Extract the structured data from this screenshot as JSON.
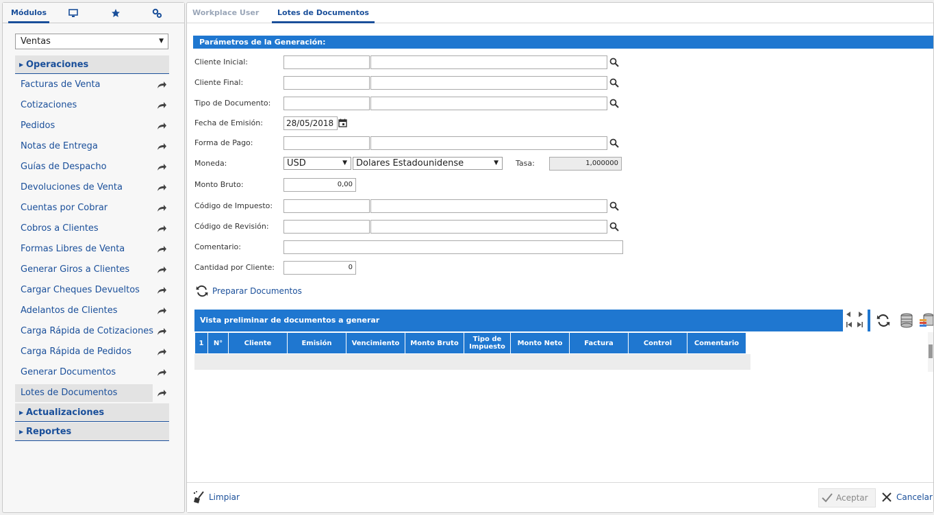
{
  "left_tabs": {
    "modules_label": "Módulos"
  },
  "module_select": {
    "value": "Ventas"
  },
  "sections": {
    "operaciones": "Operaciones",
    "actualizaciones": "Actualizaciones",
    "reportes": "Reportes"
  },
  "menu_items": [
    "Facturas de Venta",
    "Cotizaciones",
    "Pedidos",
    "Notas de Entrega",
    "Guías de Despacho",
    "Devoluciones de Venta",
    "Cuentas por Cobrar",
    "Cobros a Clientes",
    "Formas Libres de Venta",
    "Generar Giros a Clientes",
    "Cargar Cheques Devueltos",
    "Adelantos de Clientes",
    "Carga Rápida de Cotizaciones",
    "Carga Rápida de Pedidos",
    "Generar Documentos",
    "Lotes de Documentos"
  ],
  "top_tabs": {
    "workplace": "Workplace User",
    "lotes": "Lotes de Documentos"
  },
  "params": {
    "title": "Parámetros de la Generación:",
    "cliente_inicial": "Cliente Inicial:",
    "cliente_final": "Cliente Final:",
    "tipo_documento": "Tipo de Documento:",
    "fecha_emision": "Fecha de Emisión:",
    "fecha_value": "28/05/2018",
    "forma_pago": "Forma de Pago:",
    "moneda": "Moneda:",
    "moneda_code": "USD",
    "moneda_name": "Dolares Estadounidense",
    "tasa": "Tasa:",
    "tasa_value": "1,000000",
    "monto_bruto": "Monto Bruto:",
    "monto_value": "0,00",
    "codigo_impuesto": "Código de Impuesto:",
    "codigo_revision": "Código de Revisión:",
    "comentario": "Comentario:",
    "cantidad": "Cantidad por Cliente:",
    "cantidad_value": "0",
    "preparar": "Preparar Documentos"
  },
  "preview": {
    "title": "Vista preliminar de documentos a generar",
    "columns": [
      "1",
      "N°",
      "Cliente",
      "Emisión",
      "Vencimiento",
      "Monto Bruto",
      "Tipo de Impuesto",
      "Monto Neto",
      "Factura",
      "Control",
      "Comentario"
    ]
  },
  "footer": {
    "limpiar": "Limpiar",
    "aceptar": "Aceptar",
    "cancelar": "Cancelar"
  },
  "colors": {
    "accent": "#1f77d0",
    "nav": "#1a4f9a"
  }
}
